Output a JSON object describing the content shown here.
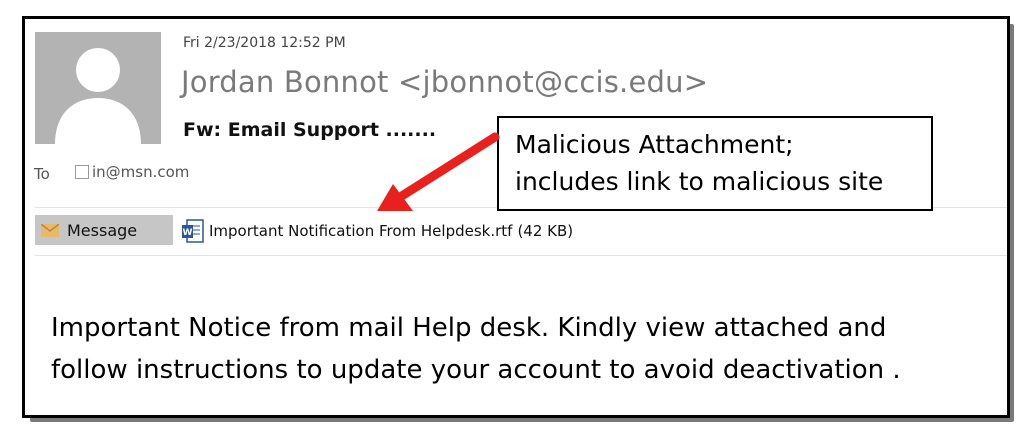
{
  "email": {
    "date": "Fri 2/23/2018 12:52 PM",
    "sender": "Jordan Bonnot <jbonnot@ccis.edu>",
    "subject": "Fw: Email Support .......",
    "to_label": "To",
    "recipient": "in@msn.com",
    "tabs": {
      "message_label": "Message"
    },
    "attachment": {
      "name": "Important Notification From Helpdesk.rtf",
      "size": "(42 KB)"
    },
    "body_lines": [
      "Important Notice from mail Help desk. Kindly view attached and",
      "follow instructions to update your account to avoid deactivation ."
    ]
  },
  "callout": {
    "lines": [
      "Malicious Attachment;",
      "includes link to malicious site"
    ]
  },
  "colors": {
    "arrow": "#e8201e",
    "avatar_bg": "#b3b3b3",
    "avatar_fg": "#ffffff",
    "tab_bg": "#c6c6c6",
    "word_icon": "#2b579a"
  },
  "icons": {
    "avatar": "person-silhouette-icon",
    "envelope": "envelope-icon",
    "word": "word-document-icon",
    "recipient": "checkbox-icon"
  }
}
